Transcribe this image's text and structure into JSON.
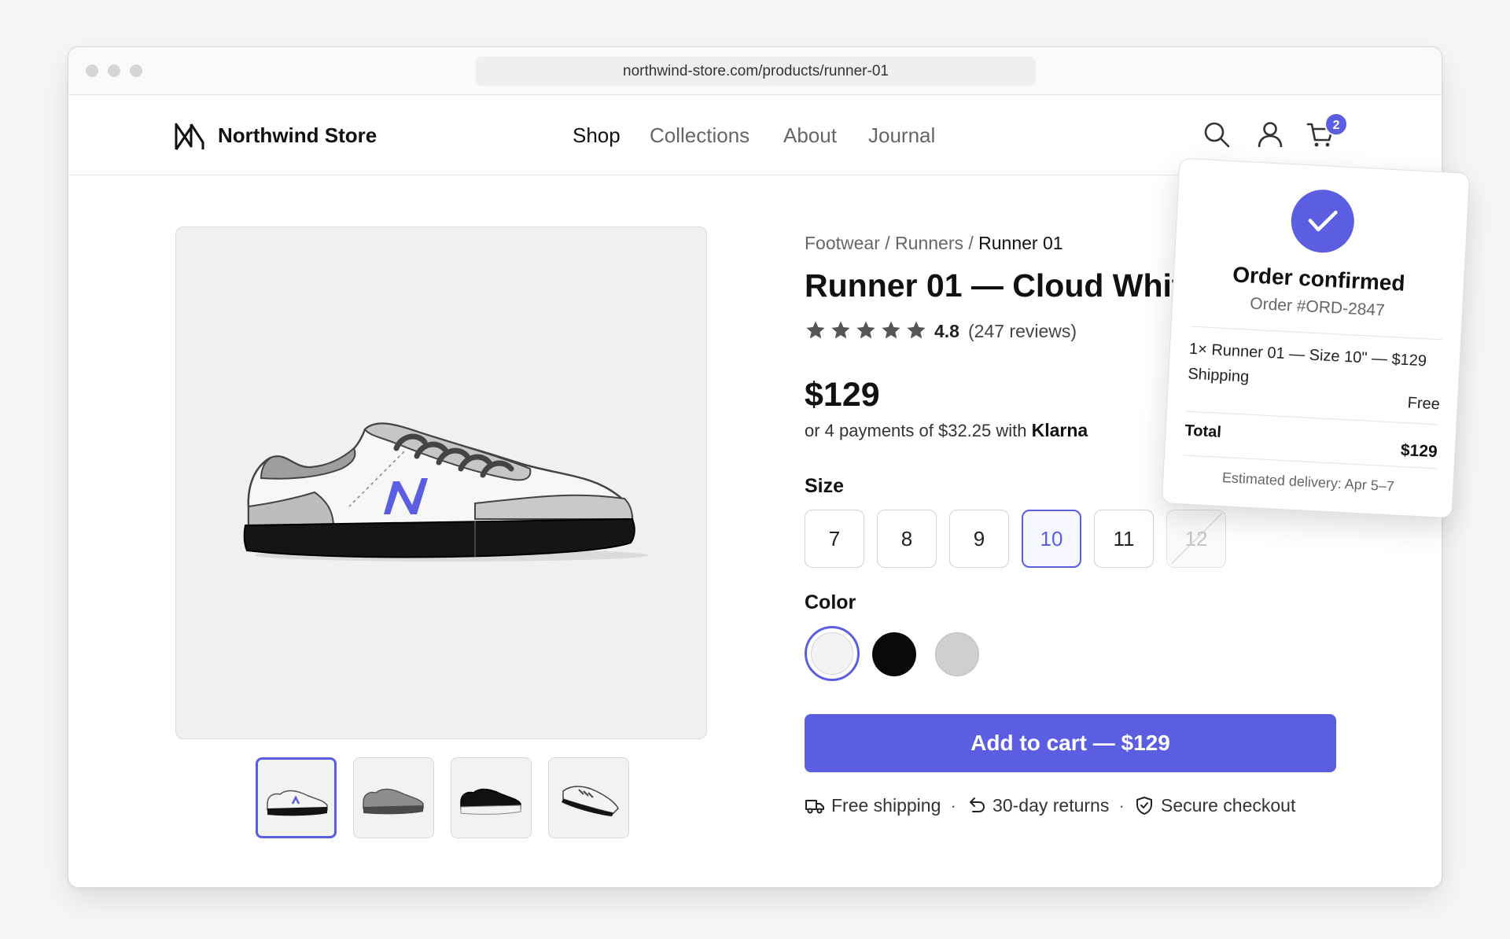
{
  "browser": {
    "url": "northwind-store.com/products/runner-01"
  },
  "nav": {
    "brand": "Northwind Store",
    "links": [
      "Shop",
      "Collections",
      "About",
      "Journal"
    ],
    "cart_count": "2"
  },
  "product": {
    "breadcrumb": [
      "Footwear",
      "Runners",
      "Runner 01"
    ],
    "breadcrumb_sep": " / ",
    "title": "Runner 01 — Cloud White",
    "rating": "4.8",
    "rating_stars": 4.8,
    "reviews": "(247 reviews)",
    "price": "$129",
    "installments_prefix": "or 4 payments of $32.25 with",
    "installments_brand": "Klarna",
    "size_label": "Size",
    "sizes": [
      "7",
      "8",
      "9",
      "10",
      "11",
      "12"
    ],
    "selected_size": "10",
    "unavailable_size": "12",
    "color_label": "Color",
    "colors": [
      "#f3f3f3",
      "#0a0a0a",
      "#cfcfd1"
    ],
    "add_to_cart": "Add to cart — $129",
    "perks": [
      "Free shipping",
      "30-day returns",
      "Secure checkout"
    ],
    "perk_sep": "·",
    "accent_color": "#5b5ee0"
  },
  "order": {
    "title": "Order confirmed",
    "id": "Order #ORD-2847",
    "line_item": "1× Runner 01 — Size 10\" — $129",
    "shipping_label": "Shipping",
    "shipping_value": "Free",
    "total_label": "Total",
    "total_value": "$129",
    "eta": "Estimated delivery: Apr 5–7"
  }
}
